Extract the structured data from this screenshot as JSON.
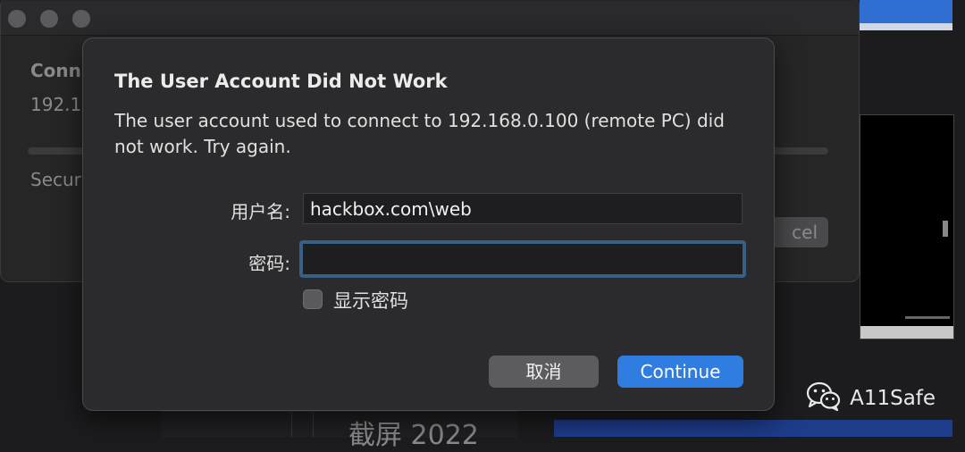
{
  "background_window": {
    "title_partial": "Conn",
    "host_partial": "192.16",
    "security_partial": "Secur",
    "cancel_partial": "cel"
  },
  "background_bottom": {
    "text_partial": "截屏 2022"
  },
  "dialog": {
    "title": "The User Account Did Not Work",
    "message": "The user account used to connect to 192.168.0.100 (remote PC) did not work. Try again.",
    "username_label": "用户名:",
    "username_value": "hackbox.com\\web",
    "password_label": "密码:",
    "password_value": "",
    "show_password_label": "显示密码",
    "show_password_checked": false,
    "cancel_label": "取消",
    "continue_label": "Continue"
  },
  "watermark": {
    "icon": "wechat-icon",
    "text": "A11Safe"
  },
  "colors": {
    "accent": "#2f7de0",
    "focus_ring": "#3a5f86",
    "dialog_bg": "#2b2b2d"
  }
}
